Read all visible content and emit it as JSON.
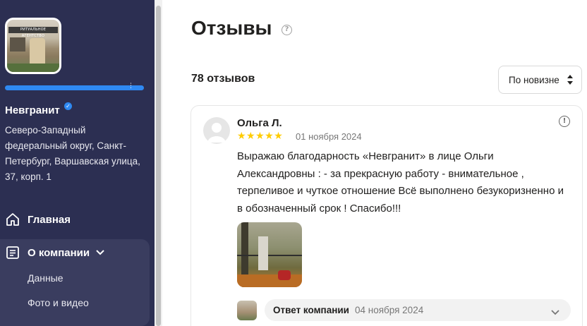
{
  "sidebar": {
    "logo_sign_text": "РИТУАЛЬНОЕ АГЕНТСТВО",
    "company_name": "Невгранит",
    "address": "Северо-Западный федеральный округ, Санкт-Петербург, Варшавская улица, 37, корп. 1",
    "nav": {
      "home_label": "Главная",
      "about_label": "О компании",
      "sub_items": [
        "Данные",
        "Фото и видео"
      ]
    },
    "rating_bar_color": "#2f89f2",
    "background_color": "#2c2f52"
  },
  "main": {
    "title": "Отзывы",
    "reviews_count": "78 отзывов",
    "sort": {
      "selected": "По новизне"
    },
    "review": {
      "author": "Ольга Л.",
      "rating": 5,
      "stars": "★★★★★",
      "date": "01 ноября 2024",
      "text": "Выражаю благодарность «Невгранит» в лице Ольги Александровны : - за прекрасную работу - внимательное , терпеливое и чуткое отношение Всё выполнено безукоризненно и в обозначенный срок ! Спасибо!!!",
      "reply": {
        "label": "Ответ компании",
        "date": "04 ноября 2024"
      }
    }
  },
  "icons": {
    "verified": "verified-check-icon",
    "help": "help-question-icon",
    "report": "report-exclamation-icon",
    "home": "home-icon",
    "about": "document-icon",
    "chevron": "chevron-down-icon",
    "sort": "sort-arrows-icon"
  },
  "colors": {
    "star": "#ffcc00",
    "accent": "#2f89f2"
  }
}
